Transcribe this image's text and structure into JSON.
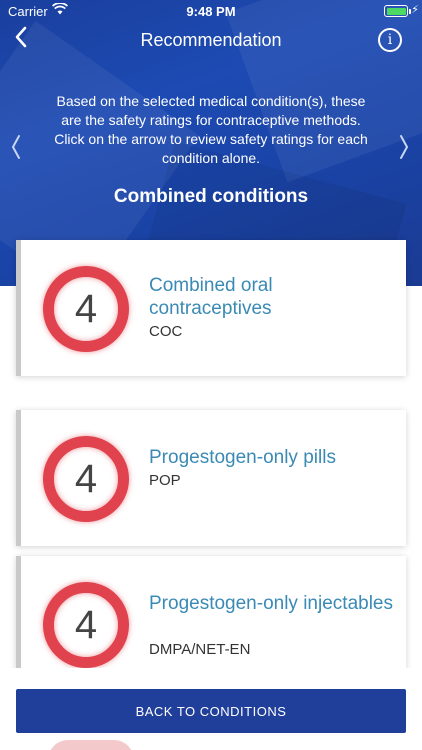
{
  "status_bar": {
    "carrier": "Carrier",
    "time": "9:48 PM",
    "battery_color": "#4cd964"
  },
  "nav": {
    "back_icon": "chevron-left-icon",
    "title": "Recommendation",
    "info_icon": "info-icon",
    "info_glyph": "i"
  },
  "intro": {
    "text": "Based on the selected medical condition(s), these are the safety ratings for contraceptive methods. Click on the arrow to review safety ratings for each condition alone."
  },
  "section": {
    "title": "Combined conditions"
  },
  "cards": [
    {
      "rating": "4",
      "name": "Combined oral contraceptives",
      "abbr": "COC"
    },
    {
      "rating": "4",
      "name": "Progestogen-only pills",
      "abbr": "POP"
    },
    {
      "rating": "4",
      "name": "Progestogen-only injectables",
      "abbr": "DMPA/NET-EN"
    }
  ],
  "footer": {
    "back_button_label": "BACK TO CONDITIONS"
  },
  "colors": {
    "header_blue": "#1d4bb3",
    "rating_red": "#e0434e",
    "method_name": "#3a8ab5",
    "button_blue": "#1f3f9a"
  }
}
